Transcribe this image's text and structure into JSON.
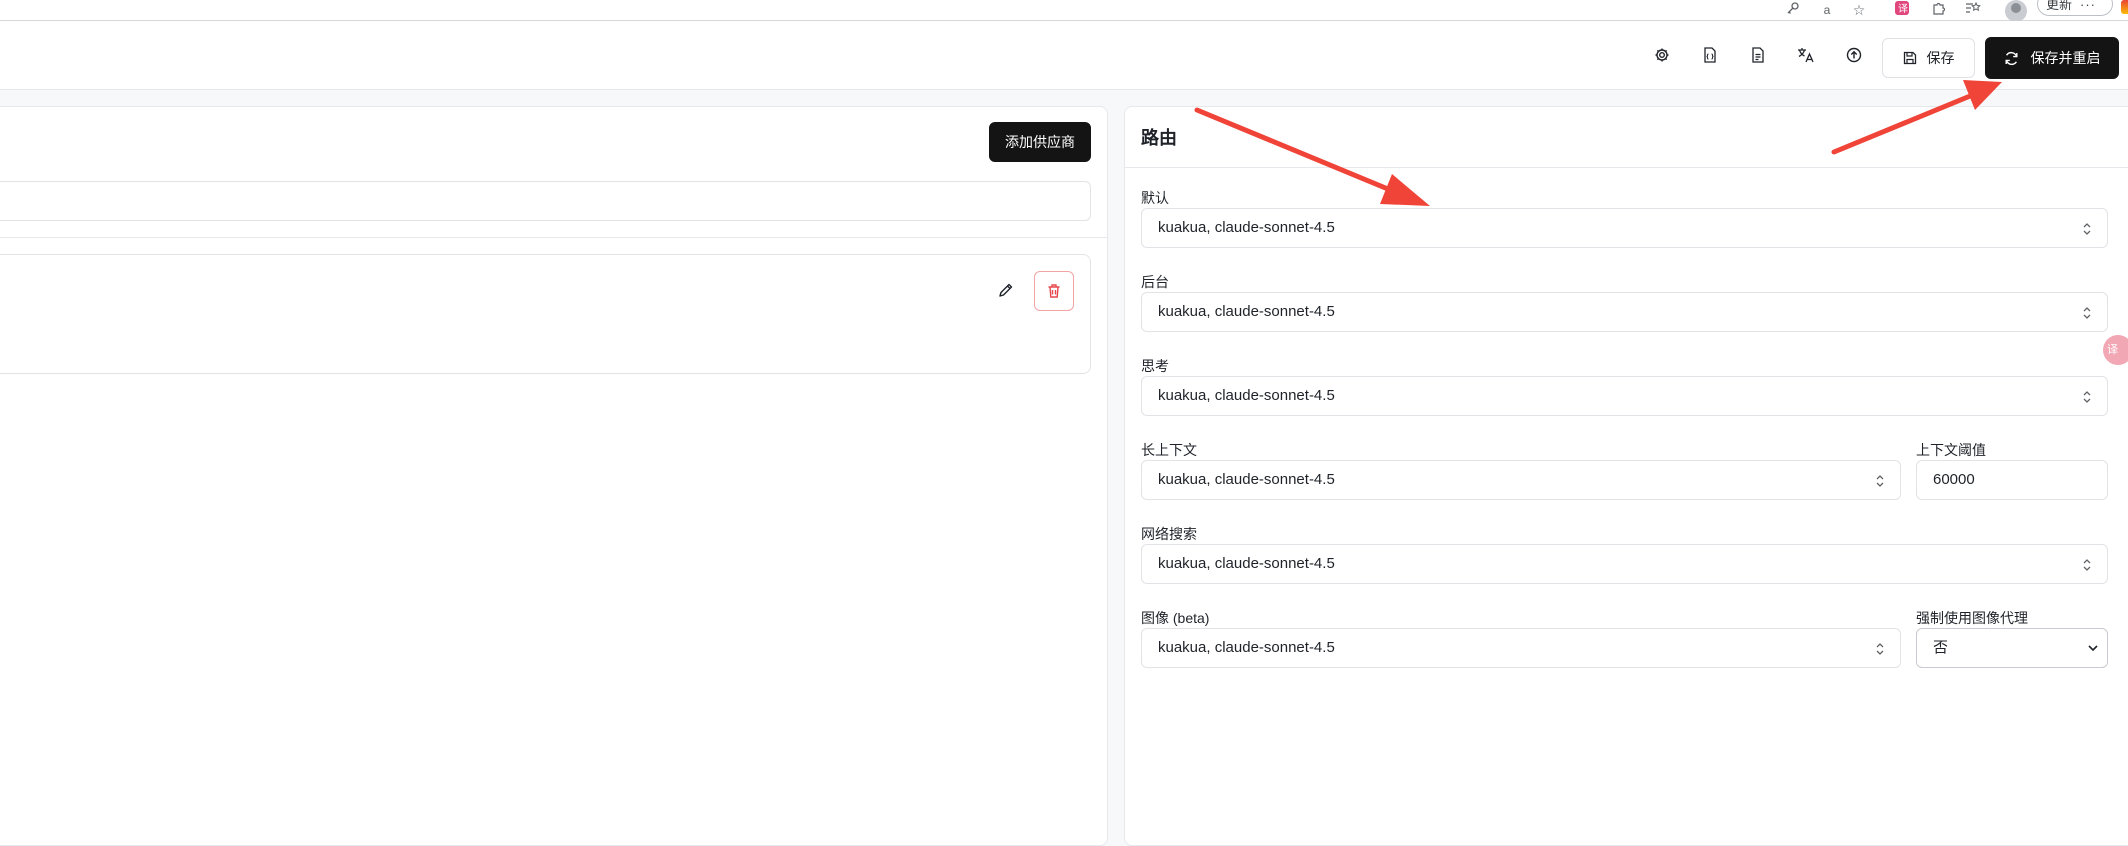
{
  "browser": {
    "update_label": "更新",
    "more_label": "···"
  },
  "header": {
    "save_label": "保存",
    "save_restart_label": "保存并重启"
  },
  "providers": {
    "add_label": "添加供应商"
  },
  "routing": {
    "title": "路由",
    "fields": {
      "default": {
        "label": "默认",
        "value": "kuakua, claude-sonnet-4.5"
      },
      "background": {
        "label": "后台",
        "value": "kuakua, claude-sonnet-4.5"
      },
      "think": {
        "label": "思考",
        "value": "kuakua, claude-sonnet-4.5"
      },
      "long_context": {
        "label": "长上下文",
        "value": "kuakua, claude-sonnet-4.5"
      },
      "context_threshold": {
        "label": "上下文阈值",
        "value": "60000"
      },
      "web_search": {
        "label": "网络搜索",
        "value": "kuakua, claude-sonnet-4.5"
      },
      "image": {
        "label": "图像 (beta)",
        "value": "kuakua, claude-sonnet-4.5"
      },
      "force_image_proxy": {
        "label": "强制使用图像代理",
        "value": "否",
        "options": [
          "否"
        ]
      }
    }
  },
  "colors": {
    "primary_button": "#141414",
    "delete_red": "#e5484d",
    "annotation_arrow": "#f04438"
  },
  "icons": {
    "header": [
      "gear-icon",
      "file-json-icon",
      "file-text-icon",
      "translate-icon",
      "upload-icon"
    ],
    "browser": [
      "key-icon",
      "read-aloud-icon",
      "star-icon",
      "translate-ext-icon",
      "puzzle-icon",
      "favorites-icon",
      "profile-avatar"
    ]
  }
}
